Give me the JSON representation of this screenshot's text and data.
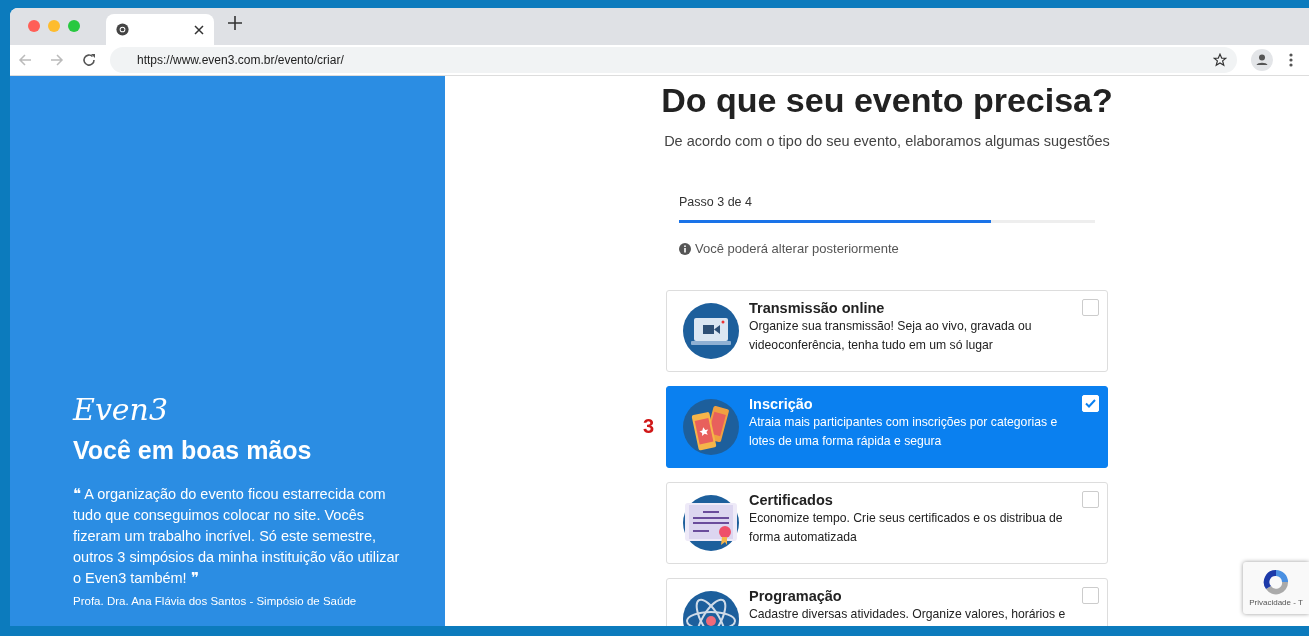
{
  "browser": {
    "url": "https://www.even3.com.br/evento/criar/"
  },
  "sidebar": {
    "logo": "Even3",
    "title": "Você em boas mãos",
    "quote_open": "❝",
    "quote": "A organização do evento ficou estarrecida com tudo que conseguimos colocar no site. Vocês fizeram um trabalho incrível. Só este semestre, outros 3 simpósios da minha instituição vão utilizar o Even3 também!",
    "quote_close": "❞",
    "author": "Profa. Dra. Ana Flávia dos Santos - Simpósio de Saúde"
  },
  "main": {
    "title": "Do que seu evento precisa?",
    "subtitle": "De acordo com o tipo do seu evento, elaboramos algumas sugestões",
    "progress": {
      "label": "Passo 3 de 4",
      "level": 0.75
    },
    "note": "Você poderá alterar posteriormente",
    "options": [
      {
        "kind": "video",
        "title": "Transmissão online",
        "description": "Organize sua transmissão! Seja ao vivo, gravada ou videoconferência, tenha tudo em um só lugar",
        "selected": false
      },
      {
        "kind": "tickets",
        "title": "Inscrição",
        "description": "Atraia mais participantes com inscrições por categorias e lotes de uma forma rápida e segura",
        "selected": true,
        "annotation": "3"
      },
      {
        "kind": "certificate",
        "title": "Certificados",
        "description": "Economize tempo. Crie seus certificados e os distribua de forma automatizada",
        "selected": false
      },
      {
        "kind": "atom",
        "title": "Programação",
        "description": "Cadastre diversas atividades. Organize valores, horários e",
        "selected": false
      }
    ]
  },
  "recaptcha": {
    "text": "Privacidade - T"
  }
}
